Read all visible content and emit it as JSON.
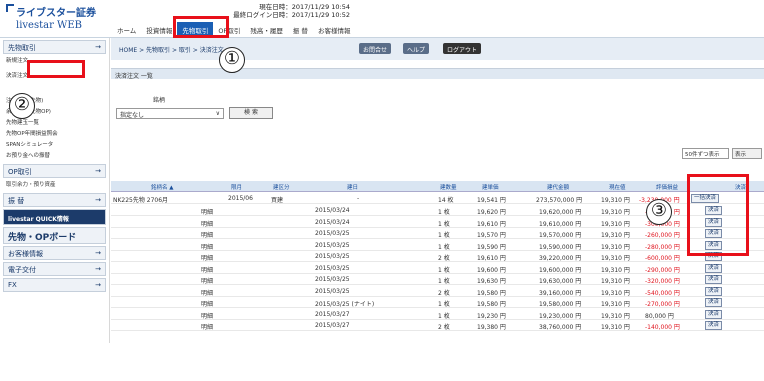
{
  "header": {
    "logo_top": "ライブスター証券",
    "logo_bottom": "livestar WEB",
    "now_time": "現在日時：2017/11/29 10:54",
    "last_login": "最終ログイン日時：2017/11/29 10:52"
  },
  "nav": [
    "ホーム",
    "投資情報",
    "先物取引",
    "OP取引",
    "残高・履歴",
    "振 替",
    "お客様情報"
  ],
  "sidebar": {
    "head1": "先物取引",
    "items1": [
      "新規注文",
      "決済注文",
      "注文照会(先物)",
      "余力照会(先物OP)",
      "先物建玉一覧",
      "先物OP年間損益照会",
      "SPANシミュレータ",
      "お預り金への振替"
    ],
    "head2": "OP取引",
    "item2": "取引余力・預り資産",
    "head3": "振 替",
    "quick": "livestar QUICK情報",
    "board": "先物・OPボード",
    "head4": "お客様情報",
    "head5": "電子交付",
    "head6": "FX",
    "arrow": "→"
  },
  "breadcrumb": "HOME > 先物取引 > 取引 > 決済注文",
  "buttons": {
    "inquiry": "お問合せ",
    "help": "ヘルプ",
    "logout": "ログアウト",
    "search": "検 索",
    "all_settle": "一括決済",
    "settle": "決済",
    "display": "表示"
  },
  "subtitle": "決済注文 一覧",
  "filter": {
    "label": "銘柄",
    "selected": "指定なし",
    "pager_select": "50件ずつ表示",
    "page_no": "1"
  },
  "table": {
    "headers": [
      "銘柄名 ▲",
      "限月",
      "建区分",
      "建日",
      "建数量",
      "建単価",
      "建代金額",
      "現在値",
      "評価損益",
      "決済"
    ],
    "summary": {
      "name": "NK225先物 2706月",
      "month": "2015/06",
      "side": "買建",
      "date": "-",
      "qty": "14 枚",
      "price": "19,541 円",
      "amount": "273,570,000 円",
      "current": "19,310 円",
      "pl": "-3,230,000 円"
    },
    "rows": [
      {
        "label": "明細",
        "date": "2015/03/24",
        "qty": "1 枚",
        "price": "19,620 円",
        "amount": "19,620,000 円",
        "current": "19,310 円",
        "pl": "-310,000 円"
      },
      {
        "label": "明細",
        "date": "2015/03/24",
        "qty": "1 枚",
        "price": "19,610 円",
        "amount": "19,610,000 円",
        "current": "19,310 円",
        "pl": "-300,000 円"
      },
      {
        "label": "明細",
        "date": "2015/03/25",
        "qty": "1 枚",
        "price": "19,570 円",
        "amount": "19,570,000 円",
        "current": "19,310 円",
        "pl": "-260,000 円"
      },
      {
        "label": "明細",
        "date": "2015/03/25",
        "qty": "1 枚",
        "price": "19,590 円",
        "amount": "19,590,000 円",
        "current": "19,310 円",
        "pl": "-280,000 円"
      },
      {
        "label": "明細",
        "date": "2015/03/25",
        "qty": "2 枚",
        "price": "19,610 円",
        "amount": "39,220,000 円",
        "current": "19,310 円",
        "pl": "-600,000 円"
      },
      {
        "label": "明細",
        "date": "2015/03/25",
        "qty": "1 枚",
        "price": "19,600 円",
        "amount": "19,600,000 円",
        "current": "19,310 円",
        "pl": "-290,000 円"
      },
      {
        "label": "明細",
        "date": "2015/03/25",
        "qty": "1 枚",
        "price": "19,630 円",
        "amount": "19,630,000 円",
        "current": "19,310 円",
        "pl": "-320,000 円"
      },
      {
        "label": "明細",
        "date": "2015/03/25",
        "qty": "2 枚",
        "price": "19,580 円",
        "amount": "39,160,000 円",
        "current": "19,310 円",
        "pl": "-540,000 円"
      },
      {
        "label": "明細",
        "date": "2015/03/25 (ナイト)",
        "qty": "1 枚",
        "price": "19,580 円",
        "amount": "19,580,000 円",
        "current": "19,310 円",
        "pl": "-270,000 円"
      },
      {
        "label": "明細",
        "date": "2015/03/27",
        "qty": "1 枚",
        "price": "19,230 円",
        "amount": "19,230,000 円",
        "current": "19,310 円",
        "pl": "80,000 円"
      },
      {
        "label": "明細",
        "date": "2015/03/27",
        "qty": "2 枚",
        "price": "19,380 円",
        "amount": "38,760,000 円",
        "current": "19,310 円",
        "pl": "-140,000 円"
      }
    ]
  },
  "annotations": [
    "①",
    "②",
    "③"
  ]
}
